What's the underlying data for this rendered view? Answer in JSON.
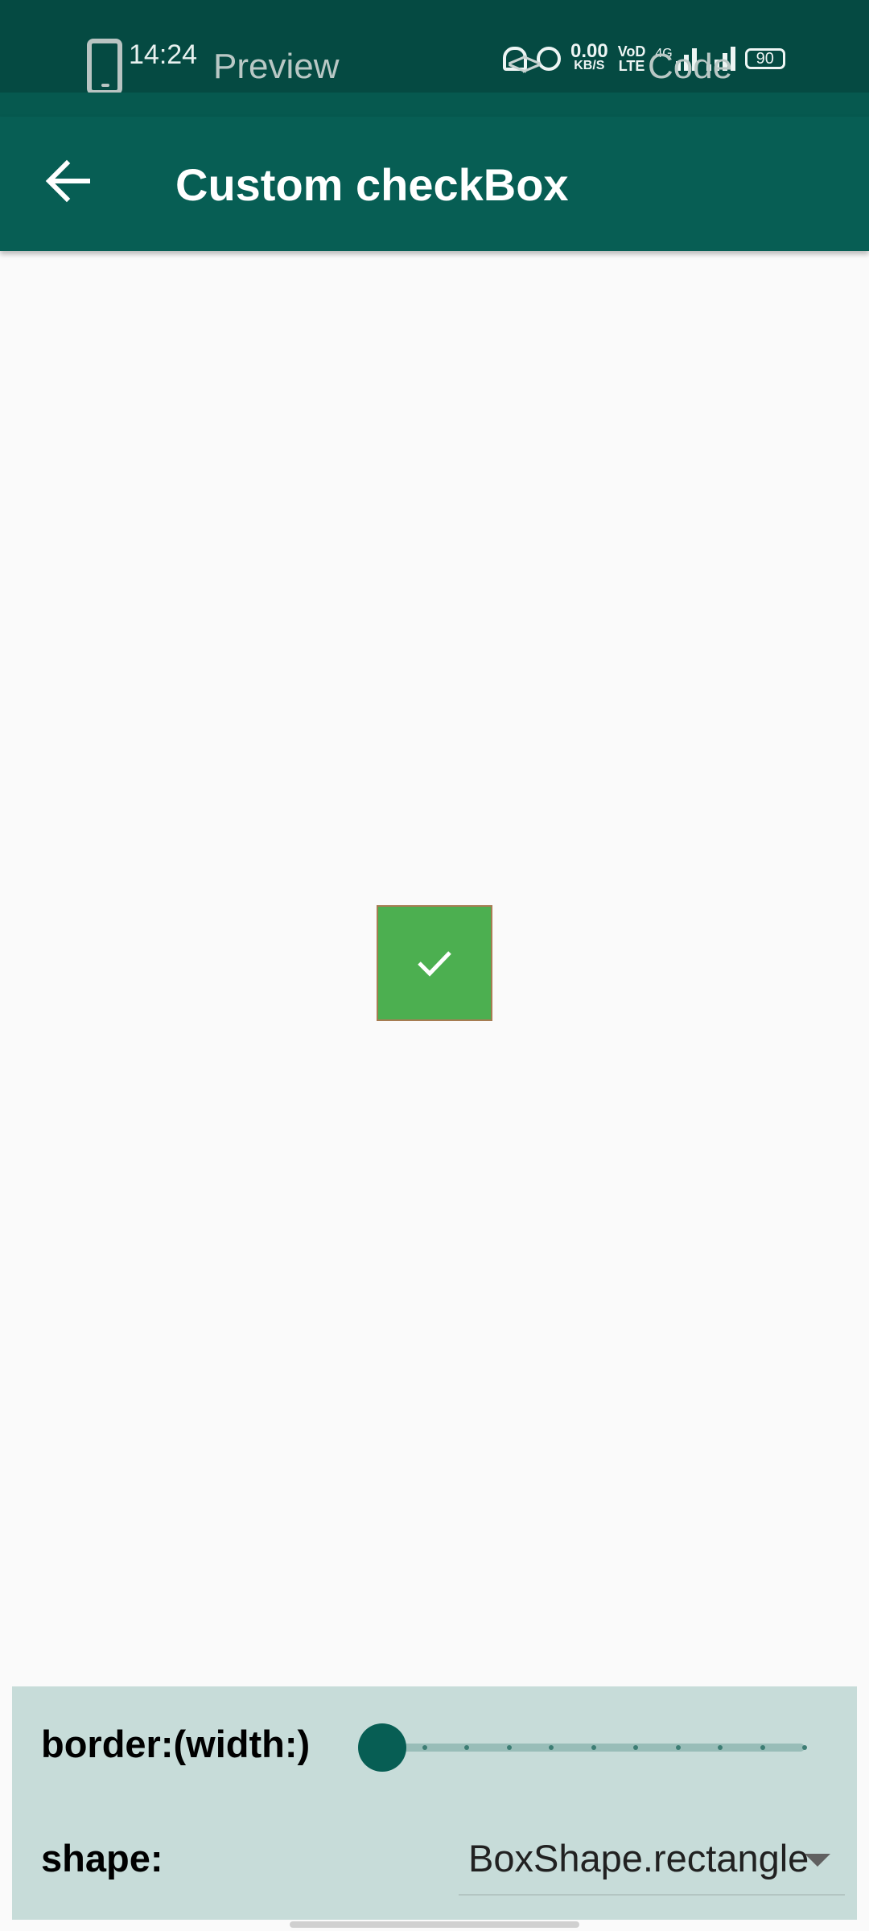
{
  "status_bar": {
    "time": "14:24",
    "speed_value": "0.00",
    "speed_unit": "KB/S",
    "volte_top": "VoD",
    "volte_bottom": "LTE",
    "network": "4G",
    "battery": "90"
  },
  "overlay_tabs": {
    "preview_label": "Preview",
    "code_label": "Code",
    "code_icon": "<>"
  },
  "app_bar": {
    "title": "Custom checkBox"
  },
  "checkbox": {
    "checked": true,
    "fill_color": "#4caf50",
    "border_color": "#a67c52"
  },
  "controls": {
    "border_label": "border:(width:)",
    "border_width_value": 0,
    "border_width_divisions": 10,
    "shape_label": "shape:",
    "shape_value": "BoxShape.rectangle"
  },
  "colors": {
    "primary": "#075e54",
    "status_bar": "#054a42",
    "panel_bg": "#c7dcd9",
    "background": "#fafafa"
  }
}
